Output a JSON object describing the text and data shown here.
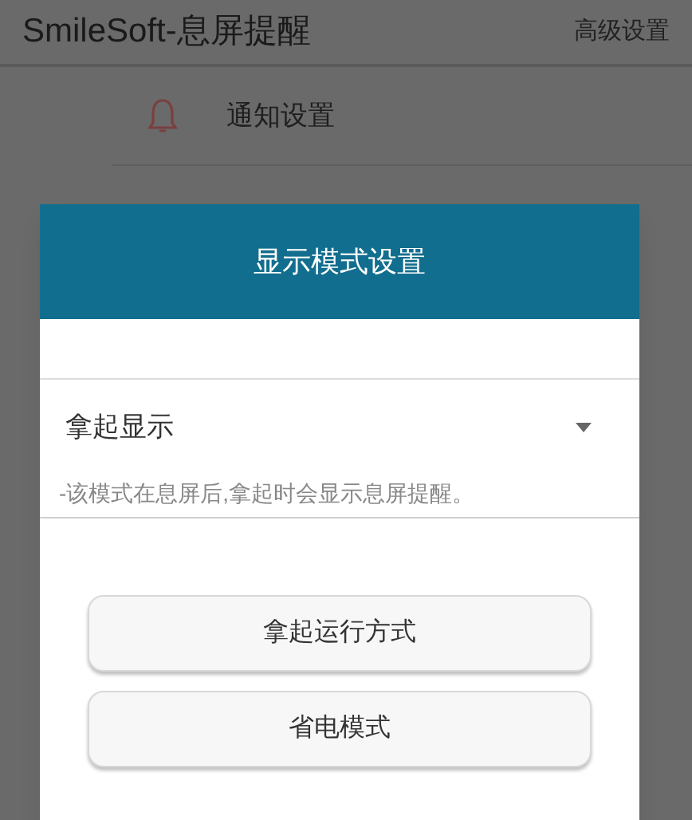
{
  "app_bar": {
    "title": "SmileSoft-息屏提醒",
    "action": "高级设置"
  },
  "settings": [
    {
      "label": "通知设置"
    }
  ],
  "dialog": {
    "title": "显示模式设置",
    "dropdown": {
      "value": "拿起显示"
    },
    "hint": "-该模式在息屏后,拿起时会显示息屏提醒。",
    "buttons": [
      "拿起运行方式",
      "省电模式"
    ]
  }
}
